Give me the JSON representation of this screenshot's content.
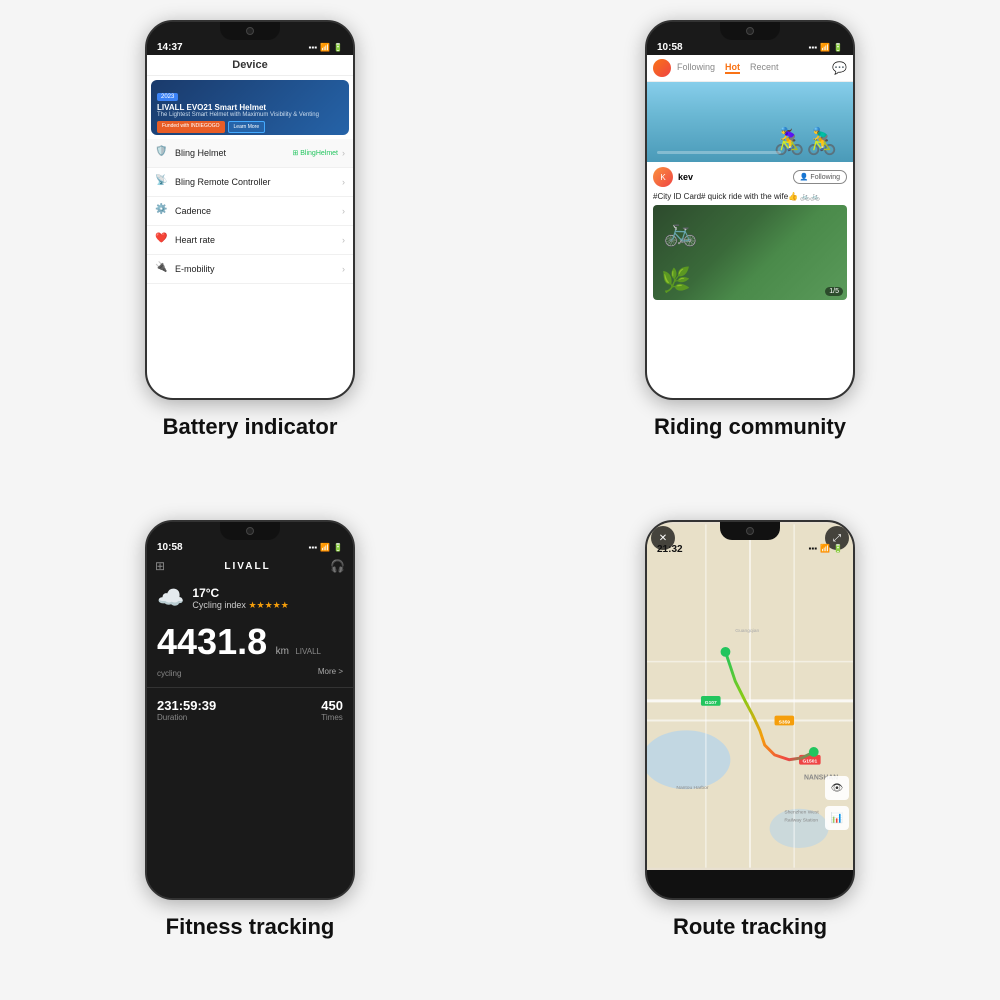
{
  "captions": {
    "battery": "Battery indicator",
    "community": "Riding community",
    "fitness": "Fitness tracking",
    "route": "Route tracking"
  },
  "phone1": {
    "time": "14:37",
    "header": "Device",
    "banner": {
      "year": "2023",
      "title": "LIVALL EVO21 Smart Helmet",
      "sub": "The Lightest Smart Helmet with Maximum Visibility & Venting",
      "btn1": "Funded with INDIEGOGO",
      "btn2": "Learn More"
    },
    "items": [
      {
        "icon": "🔋",
        "label": "Bling Helmet",
        "badge": "⊞ BlingHelmet",
        "hasBadge": true
      },
      {
        "icon": "📡",
        "label": "Bling Remote Controller",
        "badge": "",
        "hasBadge": false
      },
      {
        "icon": "⚙️",
        "label": "Cadence",
        "badge": "",
        "hasBadge": false
      },
      {
        "icon": "❤️",
        "label": "Heart rate",
        "badge": "",
        "hasBadge": false
      },
      {
        "icon": "🔌",
        "label": "E-mobility",
        "badge": "",
        "hasBadge": false
      }
    ]
  },
  "phone2": {
    "time": "10:58",
    "tabs": [
      "Following",
      "Hot",
      "Recent"
    ],
    "activeTab": "Hot",
    "post": {
      "user": "kev",
      "text": "#City ID Card#  quick ride with the wife👍\n🚲🚲",
      "counter": "1/5"
    }
  },
  "phone3": {
    "time": "10:58",
    "logo": "LIVALL",
    "weather": {
      "temp": "17°C",
      "cyclingIndex": "Cycling index",
      "stars": "★★★★★"
    },
    "distance": {
      "number": "4431.8",
      "unit": "km",
      "brand": "LIVALL cycling",
      "more": "More >"
    },
    "stats": {
      "duration": "231:59:39",
      "durationLabel": "Duration",
      "times": "450",
      "timesLabel": "Times"
    }
  },
  "phone4": {
    "time": "21:32"
  }
}
